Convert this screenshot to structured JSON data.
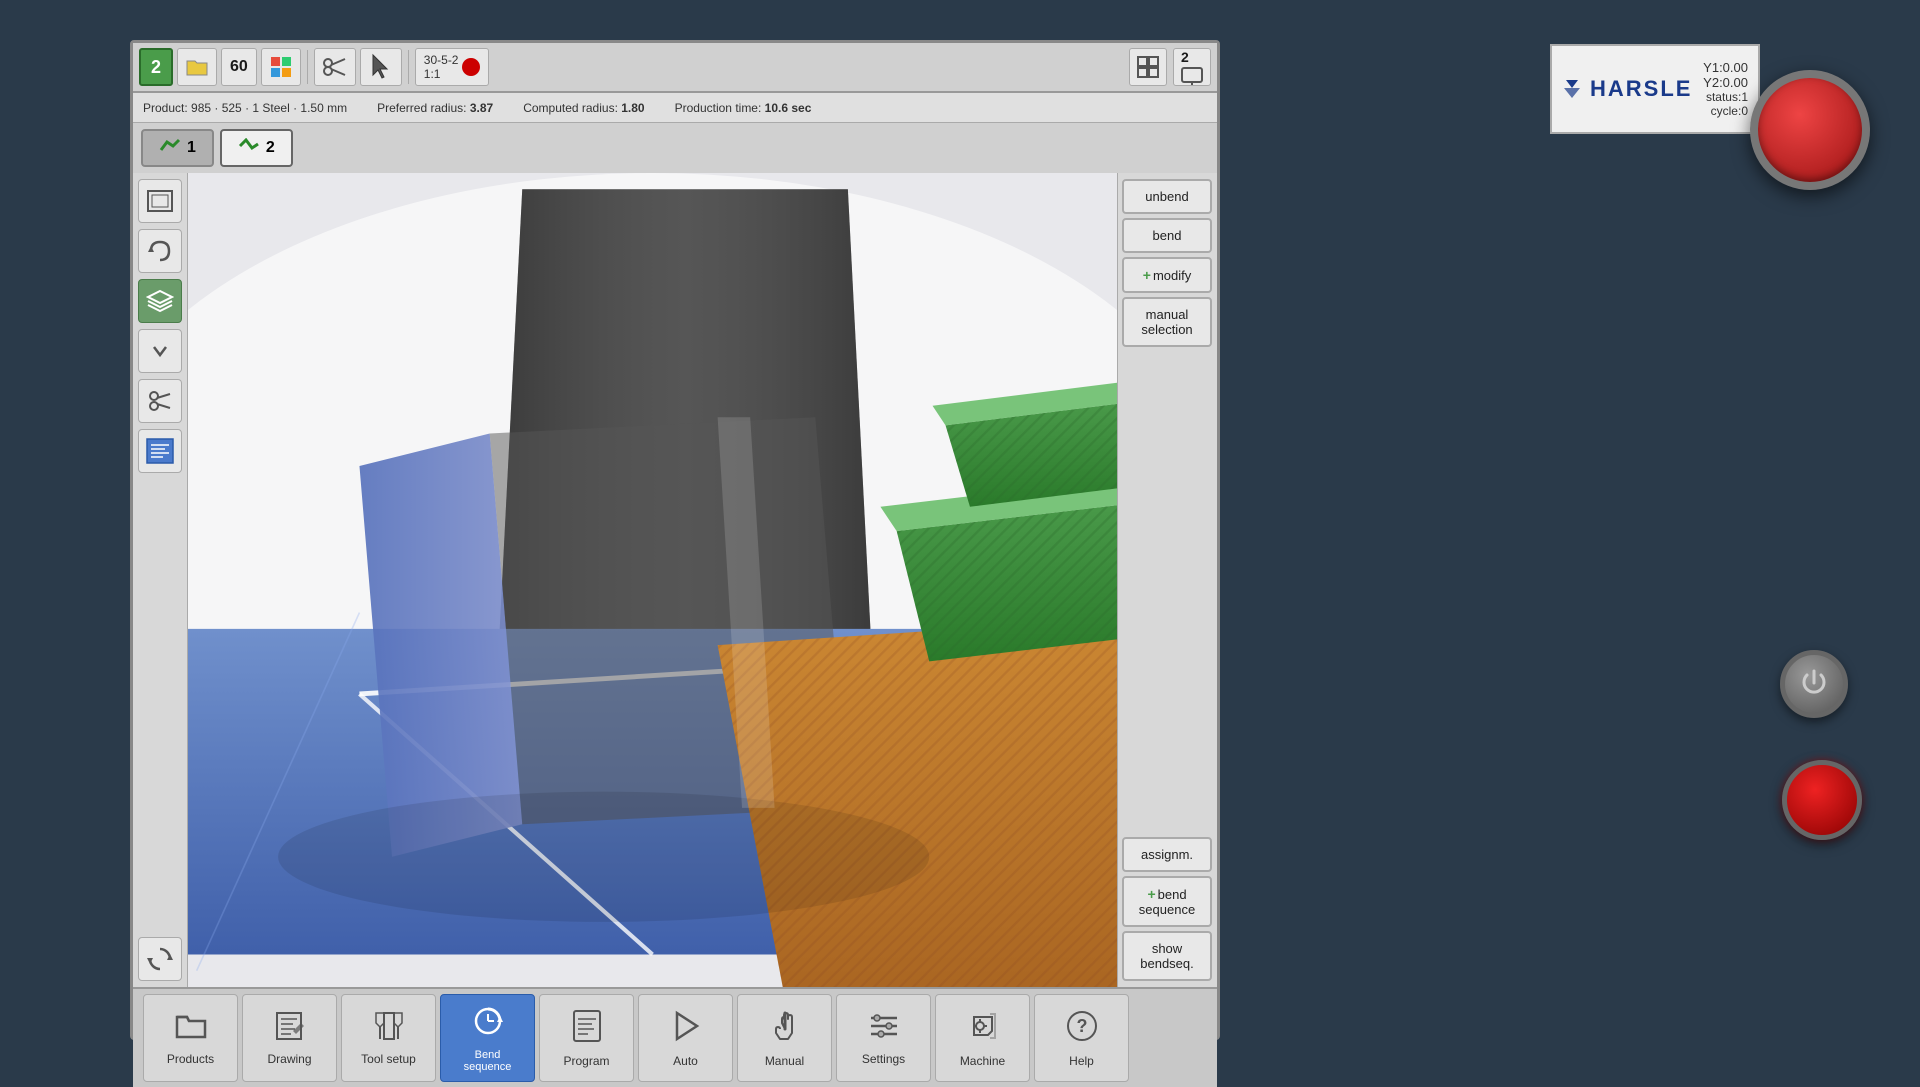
{
  "app": {
    "title": "HARSLE",
    "brand": "HARSLE"
  },
  "toolbar": {
    "step_label": "2",
    "temperature": "60",
    "touch_label": "Touch",
    "version_label": "30-5-2",
    "version_sub": "1:1",
    "grid_btn_label": "⊞",
    "monitor_btn_label": "▣",
    "monitor_num": "2"
  },
  "info_bar": {
    "product_info": "Product: 985 · 525 · 1 Steel · 1.50 mm",
    "preferred_radius_label": "Preferred radius:",
    "preferred_radius_value": "3.87",
    "computed_radius_label": "Computed radius:",
    "computed_radius_value": "1.80",
    "production_time_label": "Production time:",
    "production_time_value": "10.6 sec"
  },
  "step_tabs": [
    {
      "id": "tab1",
      "label": "1",
      "active": false
    },
    {
      "id": "tab2",
      "label": "2",
      "active": true
    }
  ],
  "right_panel": {
    "buttons": [
      {
        "id": "unbend",
        "label": "unbend",
        "has_plus": false
      },
      {
        "id": "bend",
        "label": "bend",
        "has_plus": false
      },
      {
        "id": "modify",
        "label": "modify",
        "has_plus": true
      },
      {
        "id": "manual_selection",
        "label": "manual\nselection",
        "has_plus": false
      },
      {
        "id": "assignm",
        "label": "assignm.",
        "has_plus": false
      },
      {
        "id": "bend_sequence",
        "label": "bend\nsequence",
        "has_plus": true
      },
      {
        "id": "show_bendseq",
        "label": "show\nbendseq.",
        "has_plus": false
      }
    ]
  },
  "coords": {
    "y1": "Y1:0.00",
    "y2": "Y2:0.00",
    "status": "status:1",
    "cycle": "cycle:0"
  },
  "bottom_toolbar": {
    "buttons": [
      {
        "id": "products",
        "label": "Products",
        "active": false,
        "icon": "📁"
      },
      {
        "id": "drawing",
        "label": "Drawing",
        "active": false,
        "icon": "✏️"
      },
      {
        "id": "tool_setup",
        "label": "Tool setup",
        "active": false,
        "icon": "⚙️"
      },
      {
        "id": "bend_sequence",
        "label": "Bend sequence",
        "active": true,
        "icon": "🔄"
      },
      {
        "id": "program",
        "label": "Program",
        "active": false,
        "icon": "📋"
      },
      {
        "id": "auto",
        "label": "Auto",
        "active": false,
        "icon": "▶"
      },
      {
        "id": "manual",
        "label": "Manual",
        "active": false,
        "icon": "✋"
      },
      {
        "id": "settings",
        "label": "Settings",
        "active": false,
        "icon": "☰"
      },
      {
        "id": "machine",
        "label": "Machine",
        "active": false,
        "icon": "🔧"
      },
      {
        "id": "help",
        "label": "Help",
        "active": false,
        "icon": "?"
      }
    ]
  }
}
